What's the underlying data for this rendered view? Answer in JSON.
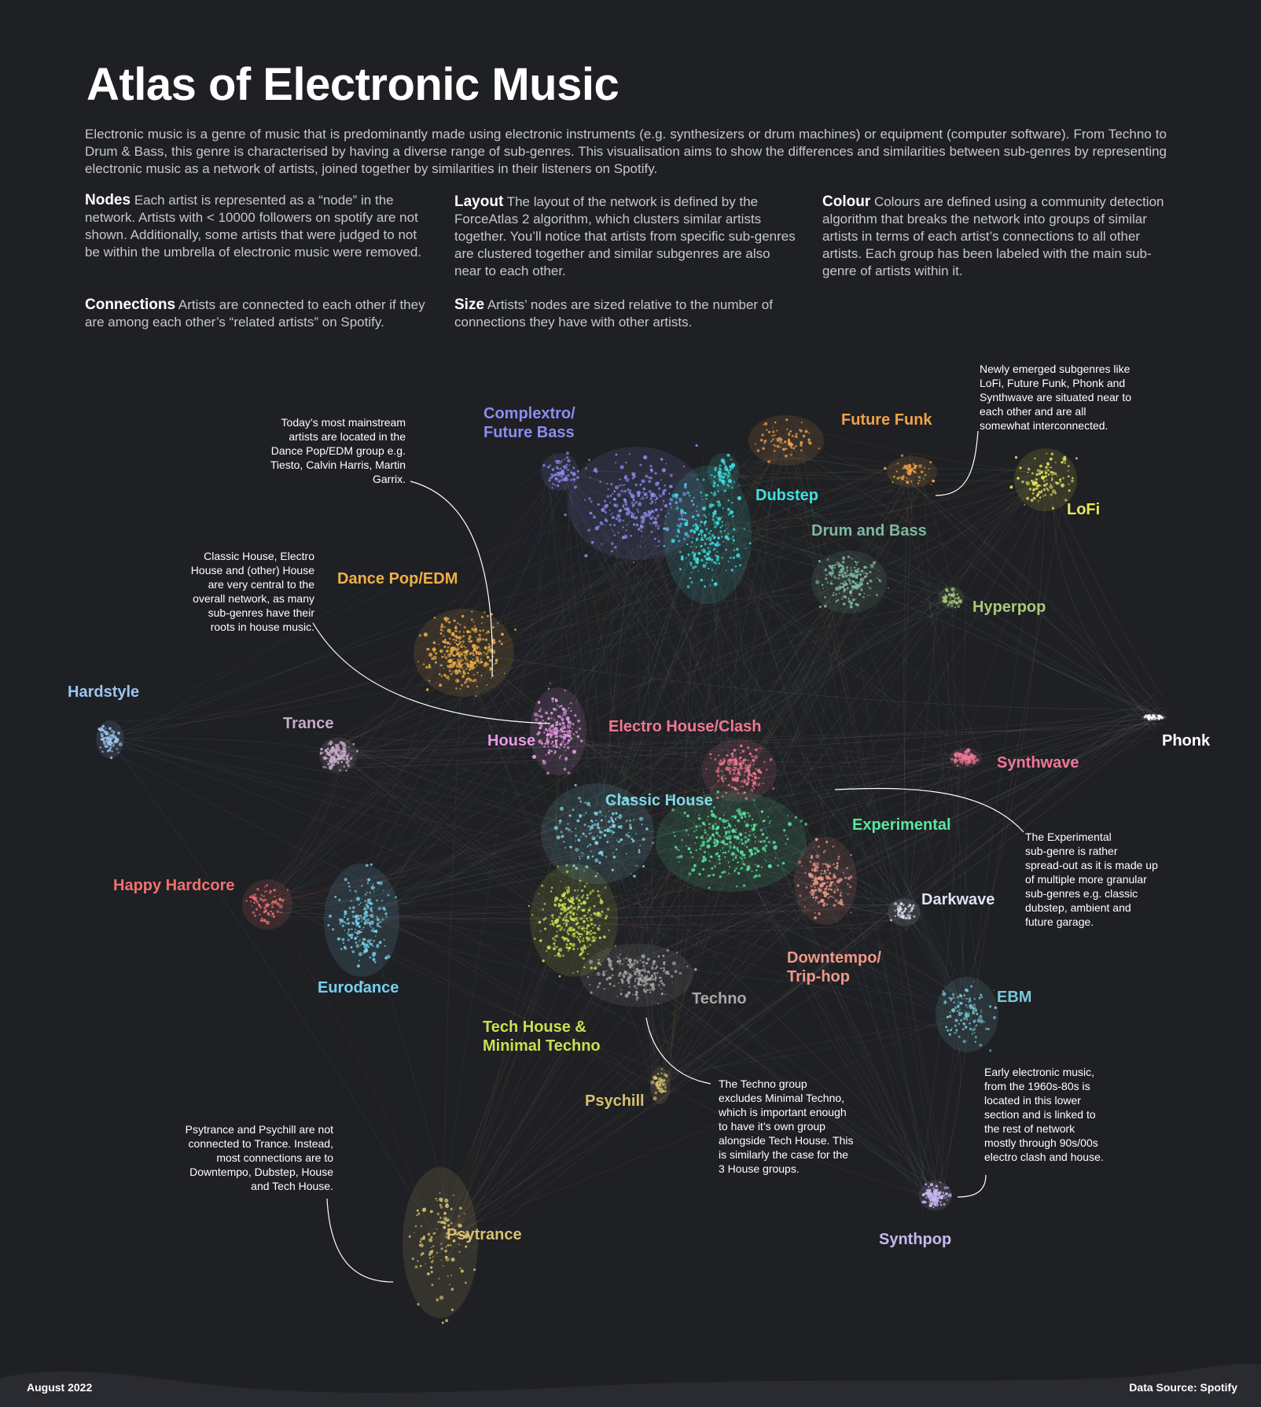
{
  "title": "Atlas of Electronic Music",
  "intro": "Electronic music is a genre of music that is predominantly made using electronic instruments (e.g. synthesizers or drum machines) or equipment (computer software). From Techno to Drum & Bass, this genre is characterised by having a diverse range of sub-genres. This visualisation aims to show the differences and similarities between sub-genres by representing electronic music as a network of artists, joined together by similarities in their listeners on Spotify.",
  "explain": {
    "nodes": {
      "lead": "Nodes",
      "text": "Each artist is represented as a “node” in the network. Artists with < 10000 followers on spotify are not shown. Additionally, some artists that were judged to not be within the umbrella of electronic music were removed."
    },
    "connections": {
      "lead": "Connections",
      "text": "Artists are connected to each other if they are among each other’s “related artists” on Spotify."
    },
    "layout": {
      "lead": "Layout",
      "text": "The layout of the network is defined by the ForceAtlas 2 algorithm, which clusters similar artists together. You’ll notice that artists from specific sub-genres are clustered together and similar subgenres are also near to each other."
    },
    "size": {
      "lead": "Size",
      "text": "Artists’ nodes are sized relative to the number of connections they have with other artists."
    },
    "colour": {
      "lead": "Colour",
      "text": "Colours are defined using a community detection algorithm that breaks the network into groups of similar artists in terms of each artist’s connections to all other artists. Each group has been labeled with the main sub-genre of artists within it."
    }
  },
  "genres": {
    "complextro": {
      "label": "Complextro/\nFuture Bass",
      "color": "#8b8cf0"
    },
    "future_funk": {
      "label": "Future Funk",
      "color": "#f0a24a"
    },
    "dubstep": {
      "label": "Dubstep",
      "color": "#3ee0e0"
    },
    "drum_and_bass": {
      "label": "Drum and Bass",
      "color": "#7fb8a0"
    },
    "lofi": {
      "label": "LoFi",
      "color": "#e8e85a"
    },
    "hyperpop": {
      "label": "Hyperpop",
      "color": "#a8c878"
    },
    "dance_pop": {
      "label": "Dance Pop/EDM",
      "color": "#f0b048"
    },
    "hardstyle": {
      "label": "Hardstyle",
      "color": "#9cc4f0"
    },
    "trance": {
      "label": "Trance",
      "color": "#c8aac8"
    },
    "house": {
      "label": "House",
      "color": "#e89ae8"
    },
    "electro_house": {
      "label": "Electro House/Clash",
      "color": "#f07890"
    },
    "phonk": {
      "label": "Phonk",
      "color": "#ffffff"
    },
    "synthwave": {
      "label": "Synthwave",
      "color": "#f07898"
    },
    "classic_house": {
      "label": "Classic House",
      "color": "#80d8e8"
    },
    "experimental": {
      "label": "Experimental",
      "color": "#58e8a0"
    },
    "happy_hardcore": {
      "label": "Happy Hardcore",
      "color": "#f07070"
    },
    "darkwave": {
      "label": "Darkwave",
      "color": "#dde4f0"
    },
    "eurodance": {
      "label": "Eurodance",
      "color": "#78d0f0"
    },
    "downtempo": {
      "label": "Downtempo/\nTrip-hop",
      "color": "#f09888"
    },
    "techno": {
      "label": "Techno",
      "color": "#a8a8a8"
    },
    "tech_house": {
      "label": "Tech House &\nMinimal Techno",
      "color": "#c8e050"
    },
    "ebm": {
      "label": "EBM",
      "color": "#78c8d8"
    },
    "psychill": {
      "label": "Psychill",
      "color": "#d8c070"
    },
    "psytrance": {
      "label": "Psytrance",
      "color": "#d8c070"
    },
    "synthpop": {
      "label": "Synthpop",
      "color": "#c8b8f0"
    }
  },
  "notes": {
    "mainstream": "Today’s most mainstream\nartists are located in the\nDance Pop/EDM group e.g.\nTiesto, Calvin Harris, Martin\nGarrix.",
    "house": "Classic House, Electro\nHouse and (other) House\nare very central to the\noverall network, as many\nsub-genres have their\nroots in house music.",
    "newly": "Newly emerged subgenres like\nLoFi, Future Funk, Phonk and\nSynthwave are situated near to\neach other and are all\nsomewhat interconnected.",
    "experimental": "The Experimental\nsub-genre is rather\nspread-out as it is made up\nof multiple more granular\nsub-genres e.g. classic\ndubstep, ambient and\nfuture garage.",
    "early": "Early electronic music,\nfrom the 1960s-80s is\nlocated in this lower\nsection and is linked to\nthe rest of network\nmostly through 90s/00s\nelectro clash and house.",
    "techno": "The Techno group\nexcludes Minimal Techno,\nwhich is important enough\nto have it’s own group\nalongside Tech House. This\nis similarly the case for the\n3 House groups.",
    "psytrance": "Psytrance and Psychill are not\nconnected to Trance. Instead,\nmost connections are to\nDowntempo, Dubstep, House\nand Tech House."
  },
  "footer": {
    "date": "August 2022",
    "source": "Data Source: Spotify"
  }
}
